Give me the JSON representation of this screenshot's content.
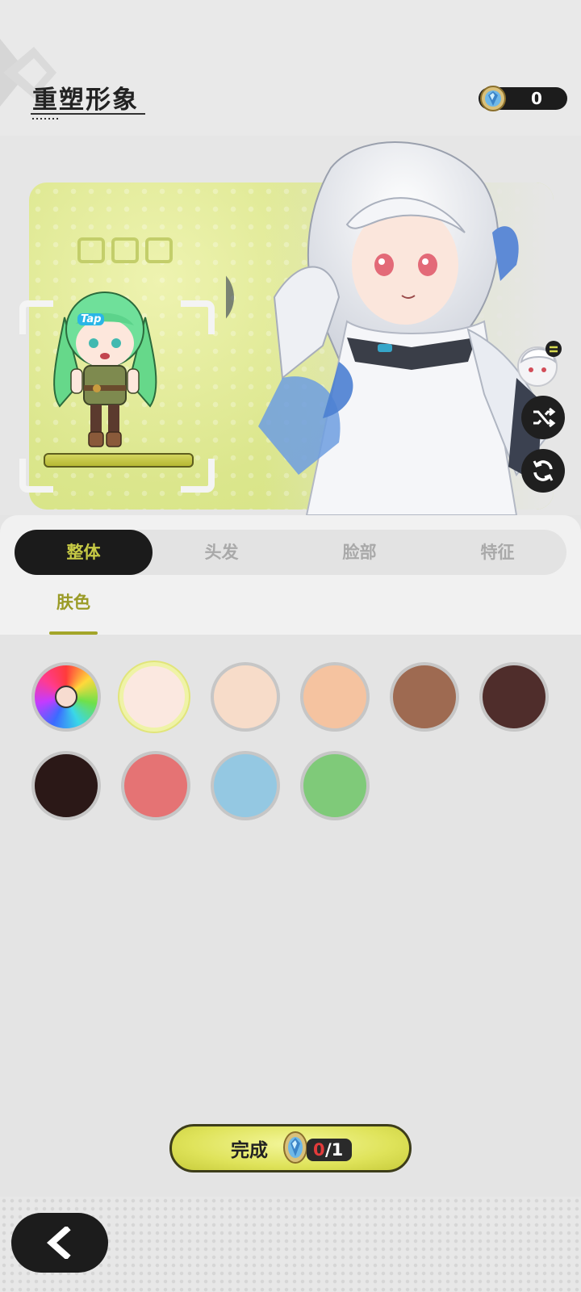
{
  "header": {
    "title": "重塑形象",
    "currency_value": "0",
    "currency_icon": "blue-gem-icon"
  },
  "preview": {
    "tap_label": "Tap",
    "shuffle_icon": "shuffle-icon",
    "refresh_icon": "refresh-icon"
  },
  "tabs": [
    {
      "label": "整体",
      "active": true
    },
    {
      "label": "头发",
      "active": false
    },
    {
      "label": "脸部",
      "active": false
    },
    {
      "label": "特征",
      "active": false
    }
  ],
  "sub_tab": {
    "label": "肤色"
  },
  "swatches": {
    "custom": "color-wheel",
    "colors": [
      "#fbe8e0",
      "#f7dcc9",
      "#f5c3a0",
      "#9e6a51",
      "#4f2d2b",
      "#2b1817",
      "#e57374",
      "#94c8e2",
      "#7fca79"
    ],
    "selected_index": 0
  },
  "done_button": {
    "label": "完成",
    "used": "0",
    "total": "/1"
  },
  "colors": {
    "accent": "#c8cb45",
    "dark": "#1b1b1b"
  }
}
